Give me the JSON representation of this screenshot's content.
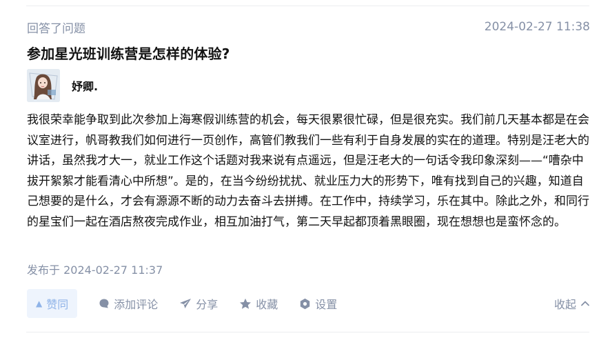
{
  "header": {
    "action_type": "回答了问题",
    "timestamp": "2024-02-27 11:38"
  },
  "question": {
    "title": "参加星光班训练营是怎样的体验?"
  },
  "author": {
    "name": "妤卿.",
    "avatar_icon": "avatar-illustration-icon"
  },
  "answer": {
    "content": "我很荣幸能争取到此次参加上海寒假训练营的机会，每天很累很忙碌，但是很充实。我们前几天基本都是在会议室进行，帆哥教我们如何进行一页创作，高管们教我们一些有利于自身发展的实在的道理。特别是汪老大的讲话，虽然我才大一，就业工作这个话题对我来说有点遥远，但是汪老大的一句话令我印象深刻——“嘈杂中拔开絮絮才能看清心中所想”。是的，在当今纷纷扰扰、就业压力大的形势下，唯有找到自己的兴趣，知道自己想要的是什么，才会有源源不断的动力去奋斗去拼搏。在工作中，持续学习，乐在其中。除此之外，和同行的星宝们一起在酒店熬夜完成作业，相互加油打气，第二天早起都顶着黑眼圈，现在想想也是蛮怀念的。",
    "published": "发布于 2024-02-27 11:37"
  },
  "actions": {
    "vote_label": "赞同",
    "comment_label": "添加评论",
    "share_label": "分享",
    "favorite_label": "收藏",
    "settings_label": "设置",
    "collapse_label": "收起"
  },
  "colors": {
    "muted": "#8590a6",
    "vote_bg": "#eef4fd",
    "vote_text": "#8fb3e8",
    "text": "#121212"
  }
}
